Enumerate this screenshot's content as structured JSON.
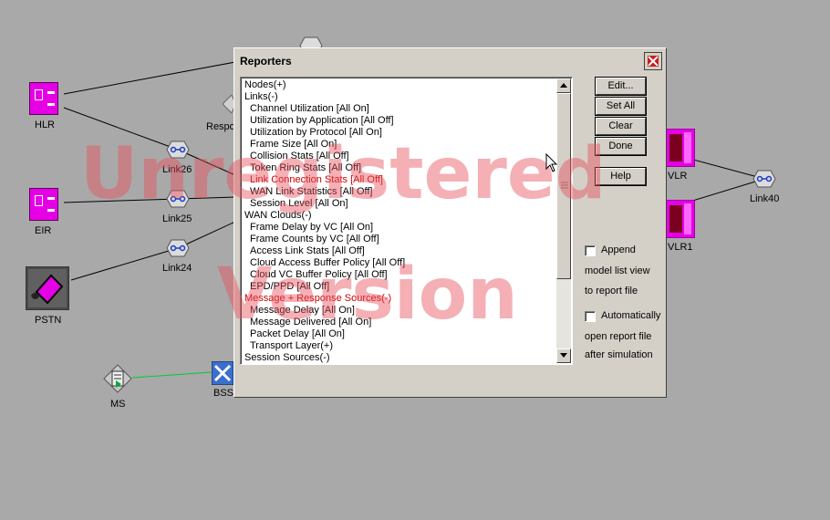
{
  "network": {
    "nodes": {
      "hlr": "HLR",
      "eir": "EIR",
      "pstn": "PSTN",
      "ms": "MS",
      "bss": "BSS",
      "respo": "Respo",
      "vlr": "VLR",
      "vlr1": "VLR1",
      "link26": "Link26",
      "link25": "Link25",
      "link24": "Link24",
      "link40": "Link40"
    },
    "link_colors": {
      "wire": "#000000",
      "ms_bss": "#00cc33"
    },
    "node_color": "#e600e6"
  },
  "watermark": {
    "line1": "Unregistered",
    "line2": "Version",
    "color": "#e6505a"
  },
  "dialog": {
    "title": "Reporters",
    "list_items": [
      {
        "text": "Nodes(+)",
        "indent": false,
        "highlight": false
      },
      {
        "text": "Links(-)",
        "indent": false,
        "highlight": false
      },
      {
        "text": "Channel Utilization [All On]",
        "indent": true,
        "highlight": false
      },
      {
        "text": "Utilization by Application [All Off]",
        "indent": true,
        "highlight": false
      },
      {
        "text": "Utilization by Protocol [All On]",
        "indent": true,
        "highlight": false
      },
      {
        "text": "Frame Size [All On]",
        "indent": true,
        "highlight": false
      },
      {
        "text": "Collision Stats [All Off]",
        "indent": true,
        "highlight": false
      },
      {
        "text": "Token Ring Stats [All Off]",
        "indent": true,
        "highlight": false
      },
      {
        "text": "Link Connection Stats [All Off]",
        "indent": true,
        "highlight": true
      },
      {
        "text": "WAN Link Statistics [All Off]",
        "indent": true,
        "highlight": false
      },
      {
        "text": "Session Level [All On]",
        "indent": true,
        "highlight": false
      },
      {
        "text": "WAN Clouds(-)",
        "indent": false,
        "highlight": false
      },
      {
        "text": "Frame Delay by VC [All On]",
        "indent": true,
        "highlight": false
      },
      {
        "text": "Frame Counts by VC [All Off]",
        "indent": true,
        "highlight": false
      },
      {
        "text": "Access Link Stats [All Off]",
        "indent": true,
        "highlight": false
      },
      {
        "text": "Cloud Access Buffer Policy [All Off]",
        "indent": true,
        "highlight": false
      },
      {
        "text": "Cloud VC Buffer Policy [All Off]",
        "indent": true,
        "highlight": false
      },
      {
        "text": "EPD/PPD [All Off]",
        "indent": true,
        "highlight": false
      },
      {
        "text": "Message + Response Sources(-)",
        "indent": false,
        "highlight": true
      },
      {
        "text": "Message Delay [All On]",
        "indent": true,
        "highlight": false
      },
      {
        "text": "Message Delivered [All On]",
        "indent": true,
        "highlight": false
      },
      {
        "text": "Packet Delay [All On]",
        "indent": true,
        "highlight": false
      },
      {
        "text": "Transport Layer(+)",
        "indent": true,
        "highlight": false
      },
      {
        "text": "Session Sources(-)",
        "indent": false,
        "highlight": false
      }
    ],
    "buttons": {
      "edit": "Edit...",
      "set_all": "Set All",
      "clear": "Clear",
      "done": "Done",
      "help": "Help"
    },
    "append": {
      "checked": false,
      "line1": "Append",
      "line2": "model list view",
      "line3": "to report file"
    },
    "auto_open": {
      "checked": false,
      "line1": "Automatically",
      "line2": "open report file",
      "line3": "after simulation"
    },
    "icons": {
      "close": "close-icon",
      "up": "arrow-up-icon",
      "down": "arrow-down-icon"
    }
  }
}
